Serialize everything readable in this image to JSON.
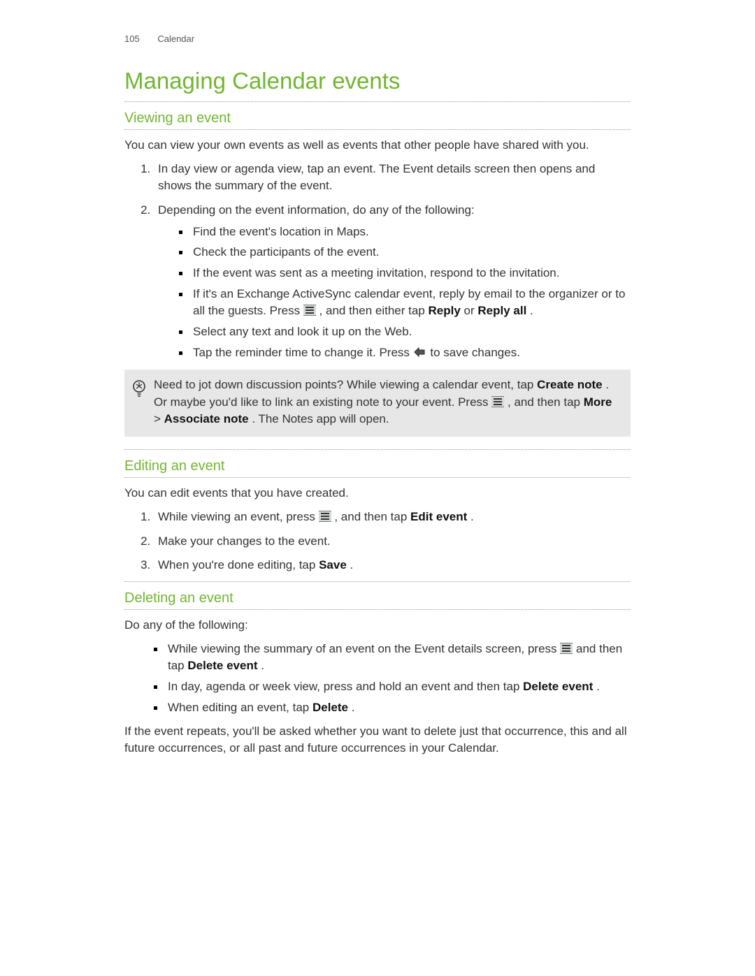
{
  "header": {
    "page_number": "105",
    "section": "Calendar"
  },
  "title": "Managing Calendar events",
  "s1": {
    "heading": "Viewing an event",
    "intro": "You can view your own events as well as events that other people have shared with you.",
    "step1": "In day view or agenda view, tap an event. The Event details screen then opens and shows the summary of the event.",
    "step2": "Depending on the event information, do any of the following:",
    "b1": "Find the event's location in Maps.",
    "b2": "Check the participants of the event.",
    "b3": "If the event was sent as a meeting invitation, respond to the invitation.",
    "b4a": "If it's an Exchange ActiveSync calendar event, reply by email to the organizer or to all the guests. Press ",
    "b4b": ", and then either tap ",
    "b4_reply": "Reply",
    "b4_or": " or ",
    "b4_replyall": "Reply all",
    "b4_period": ".",
    "b5": "Select any text and look it up on the Web.",
    "b6a": "Tap the reminder time to change it. Press ",
    "b6b": " to save changes."
  },
  "tip": {
    "t1": "Need to jot down discussion points? While viewing a calendar event, tap ",
    "create_note": "Create note",
    "t2": ". Or maybe you'd like to link an existing note to your event. Press ",
    "t3": ", and then tap ",
    "more": "More",
    "gt": " > ",
    "assoc": "Associate note",
    "t4": ". The Notes app will open."
  },
  "s2": {
    "heading": "Editing an event",
    "intro": "You can edit events that you have created.",
    "step1a": "While viewing an event, press ",
    "step1b": ", and then tap ",
    "edit_event": "Edit event",
    "period": ".",
    "step2": "Make your changes to the event.",
    "step3a": "When you're done editing, tap ",
    "save": "Save",
    "step3b": "."
  },
  "s3": {
    "heading": "Deleting an event",
    "intro": "Do any of the following:",
    "b1a": "While viewing the summary of an event on the Event details screen, press ",
    "b1b": " and then tap ",
    "delete_event": "Delete event",
    "period": ".",
    "b2a": "In day, agenda or week view, press and hold an event and then tap ",
    "b3a": "When editing an event, tap ",
    "delete": "Delete",
    "outro": "If the event repeats, you'll be asked whether you want to delete just that occurrence, this and all future occurrences, or all past and future occurrences in your Calendar."
  }
}
